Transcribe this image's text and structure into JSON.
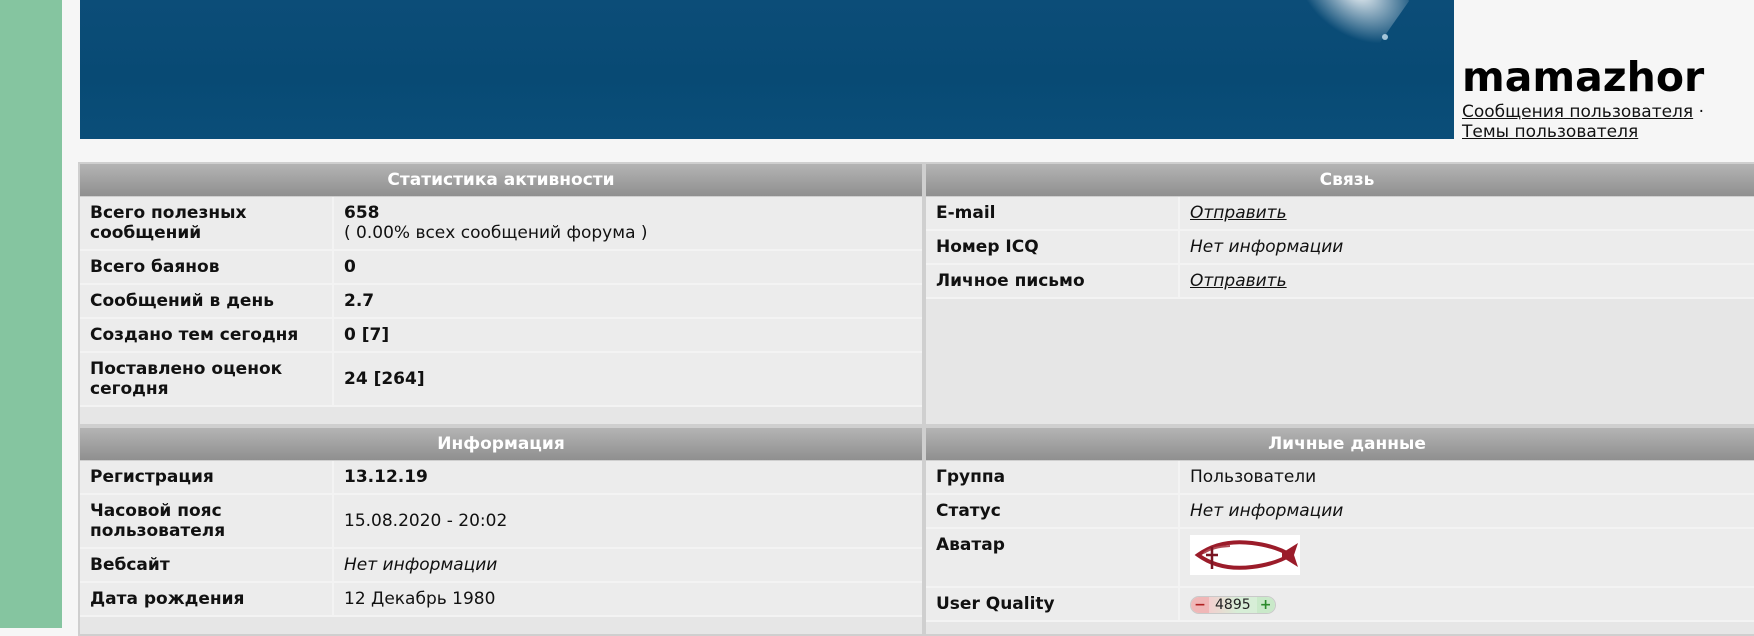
{
  "header": {
    "username": "mamazhor",
    "links": {
      "posts": "Сообщения пользователя",
      "separator": "·",
      "topics": "Темы пользователя"
    }
  },
  "activity": {
    "title": "Статистика активности",
    "rows": [
      {
        "label": "Всего полезных сообщений",
        "value": "658",
        "subvalue": "( 0.00% всех сообщений форума )"
      },
      {
        "label": "Всего баянов",
        "value": "0"
      },
      {
        "label": "Сообщений в день",
        "value": "2.7"
      },
      {
        "label": "Создано тем сегодня",
        "value": "0 [7]"
      },
      {
        "label": "Поставлено оценок сегодня",
        "value": "24 [264]"
      }
    ]
  },
  "contact": {
    "title": "Связь",
    "rows": [
      {
        "label": "E-mail",
        "value": "Отправить"
      },
      {
        "label": "Номер ICQ",
        "value": "Нет информации"
      },
      {
        "label": "Личное письмо",
        "value": "Отправить"
      }
    ]
  },
  "info": {
    "title": "Информация",
    "rows": [
      {
        "label": "Регистрация",
        "value": "13.12.19"
      },
      {
        "label": "Часовой пояс пользователя",
        "value": "15.08.2020 - 20:02"
      },
      {
        "label": "Вебсайт",
        "value": "Нет информации"
      },
      {
        "label": "Дата рождения",
        "value": "12 Декабрь 1980"
      }
    ]
  },
  "personal": {
    "title": "Личные данные",
    "rows": [
      {
        "label": "Группа",
        "value": "Пользователи"
      },
      {
        "label": "Статус",
        "value": "Нет информации"
      },
      {
        "label": "Аватар",
        "value": "avatar-fish-icon"
      },
      {
        "label": "User Quality",
        "value": "4895",
        "minus": "−",
        "plus": "+"
      }
    ]
  },
  "colors": {
    "left_stripe": "#85c5a0",
    "banner": "#0c4d78",
    "header_gradient_top": "#b4b4b4",
    "header_gradient_bottom": "#8f8f8f",
    "row_bg": "#ececec"
  }
}
